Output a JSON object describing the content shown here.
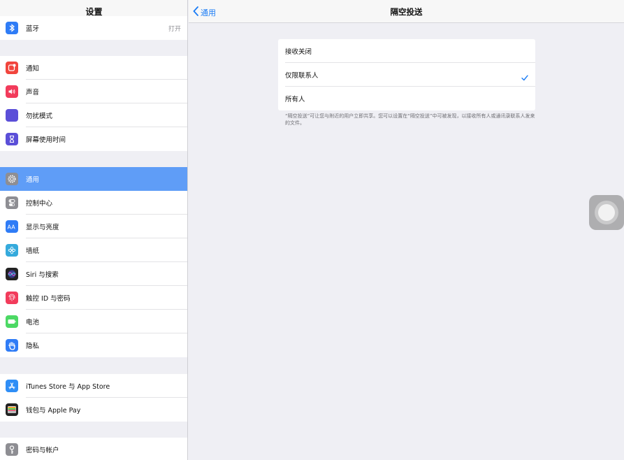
{
  "sidebar": {
    "title": "设置",
    "items": [
      {
        "key": "bluetooth",
        "label": "蓝牙",
        "value": "打开",
        "icon": "bluetooth-icon",
        "color": "#2f7cf6"
      },
      {
        "key": "notifications",
        "label": "通知",
        "icon": "notifications-icon",
        "color": "#f1453d"
      },
      {
        "key": "sounds",
        "label": "声音",
        "icon": "sounds-icon",
        "color": "#f23b5b"
      },
      {
        "key": "dnd",
        "label": "勿扰模式",
        "icon": "moon-icon",
        "color": "#5b4fd8"
      },
      {
        "key": "screentime",
        "label": "屏幕使用时间",
        "icon": "hourglass-icon",
        "color": "#5b4fd8"
      },
      {
        "key": "general",
        "label": "通用",
        "icon": "gear-icon",
        "color": "#8e8e93",
        "selected": true
      },
      {
        "key": "control",
        "label": "控制中心",
        "icon": "toggles-icon",
        "color": "#8e8e93"
      },
      {
        "key": "display",
        "label": "显示与亮度",
        "icon": "display-icon",
        "color": "#2f7cf6"
      },
      {
        "key": "wallpaper",
        "label": "墙纸",
        "icon": "wallpaper-icon",
        "color": "#35aadc"
      },
      {
        "key": "siri",
        "label": "Siri 与搜索",
        "icon": "siri-icon",
        "color": "#222"
      },
      {
        "key": "touchid",
        "label": "触控 ID 与密码",
        "icon": "fingerprint-icon",
        "color": "#f23b5b"
      },
      {
        "key": "battery",
        "label": "电池",
        "icon": "battery-icon",
        "color": "#4cd964"
      },
      {
        "key": "privacy",
        "label": "隐私",
        "icon": "hand-icon",
        "color": "#2f7cf6"
      },
      {
        "key": "itunes",
        "label": "iTunes Store 与 App Store",
        "icon": "appstore-icon",
        "color": "#2f8ef6"
      },
      {
        "key": "wallet",
        "label": "钱包与 Apple Pay",
        "icon": "wallet-icon",
        "color": "#222"
      },
      {
        "key": "passwords",
        "label": "密码与帐户",
        "icon": "key-icon",
        "color": "#8e8e93"
      }
    ]
  },
  "header": {
    "back_label": "通用",
    "title": "隔空投送"
  },
  "airdrop": {
    "options": [
      {
        "label": "接收关闭",
        "checked": false
      },
      {
        "label": "仅限联系人",
        "checked": true
      },
      {
        "label": "所有人",
        "checked": false
      }
    ],
    "footnote": "“隔空投送”可让您与附近的用户立即共享。您可以设置在“隔空投送”中可被发现，以接收所有人或通讯录联系人发来的文件。"
  },
  "colors": {
    "accent": "#1a7cf5",
    "selected_row": "#5f9df7",
    "background": "#efeff4"
  }
}
